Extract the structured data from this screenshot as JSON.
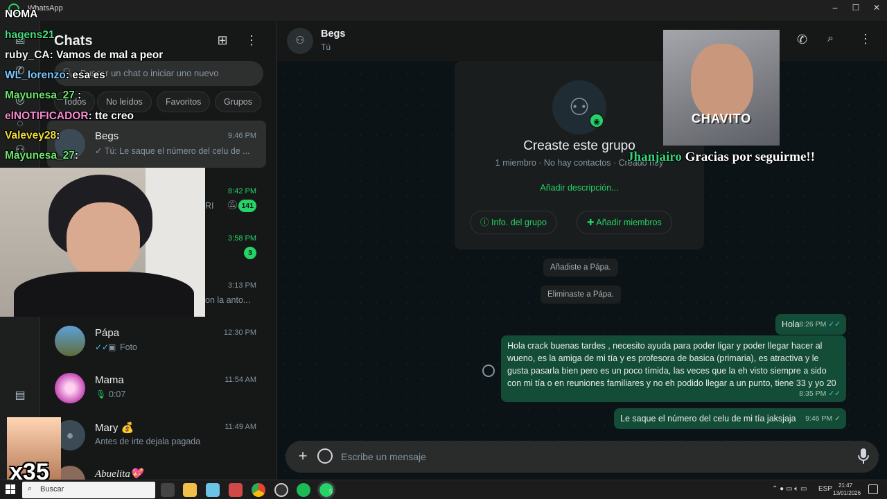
{
  "window": {
    "title": "WhatsApp"
  },
  "sidebar_list": {
    "title": "Chats",
    "search_placeholder": "Buscar un chat o iniciar uno nuevo",
    "filters": [
      "Todos",
      "No leídos",
      "Favoritos",
      "Grupos"
    ],
    "chats": [
      {
        "name": "Begs",
        "time": "9:46 PM",
        "preview": "✓ Tú: Le saque el número del celu de ...",
        "selected": true
      },
      {
        "name": "",
        "time": "8:42 PM",
        "preview": "RI",
        "badge": "141",
        "muted": true
      },
      {
        "name": "",
        "time": "3:58 PM",
        "preview": "",
        "badge": "3"
      },
      {
        "name": "",
        "time": "3:13 PM",
        "preview": "on la anto..."
      },
      {
        "name": "Pápa",
        "time": "12:30 PM",
        "preview": "Foto"
      },
      {
        "name": "Mama",
        "time": "11:54 AM",
        "preview": "0:07"
      },
      {
        "name": "Mary 💰",
        "time": "11:49 AM",
        "preview": "Antes de irte dejala pagada"
      },
      {
        "name": "Abuelita💖",
        "time": "",
        "preview": ""
      }
    ]
  },
  "conversation": {
    "name": "Begs",
    "subtitle": "Tú",
    "card": {
      "title": "Creaste este grupo",
      "subtitle": "1 miembro · No hay contactos · Creado hoy",
      "add_description": "Añadir descripción...",
      "group_info": "Info. del grupo",
      "add_members": "Añadir miembros"
    },
    "system_messages": [
      "Añadiste a Pápa.",
      "Eliminaste a Pápa."
    ],
    "messages": [
      {
        "text": "Hola",
        "time": "8:26 PM"
      },
      {
        "text": "Hola crack buenas tardes , necesito ayuda para poder ligar y poder llegar hacer al wueno, es la amiga de mi tía y es profesora de basica (primaria), es atractiva y le gusta pasarla bien pero es un poco tímida, las veces que la eh visto siempre a sido con mi tía o en reuniones familiares y no eh podido llegar a un punto, tiene 33 y yo 20",
        "time": "8:35 PM"
      },
      {
        "text": "Le saque el número del celu de mi tía jaksjaja",
        "time": "9:46 PM"
      }
    ],
    "composer_placeholder": "Escribe un mensaje"
  },
  "stream_overlay": {
    "chat": [
      {
        "user": "NOMA",
        "text": "",
        "color": "#ffffff"
      },
      {
        "user": "hagens21",
        "text": "",
        "color": "#4ade80"
      },
      {
        "user": "ruby_CA",
        "text": ": Vamos de mal a peor",
        "color": "#f2f2f2"
      },
      {
        "user": "WL_lorenzo",
        "text": ": esa es",
        "color": "#7cc6ff"
      },
      {
        "user": "Mayunesa_27",
        "text": " :",
        "color": "#6ee56e"
      },
      {
        "user": "elNOTIFICADOR",
        "text": ": tte creo",
        "color": "#f78ad0"
      },
      {
        "user": "Valevey28",
        "text": ":",
        "color": "#f3df3e"
      },
      {
        "user": "Mayunesa_27",
        "text": ":",
        "color": "#6ee56e"
      }
    ],
    "alert_caption": "CHAVITO",
    "alert_user": "Jhanjairo",
    "alert_text": "Gracias por seguirme!!",
    "emote_count": "x35"
  },
  "taskbar": {
    "search": "Buscar",
    "language": "ESP",
    "time": "21:47",
    "date": "13/01/2026",
    "whatsapp_badge": "5"
  },
  "colors": {
    "accent": "#25d366",
    "bubble": "#144d37",
    "background": "#0c1317"
  }
}
